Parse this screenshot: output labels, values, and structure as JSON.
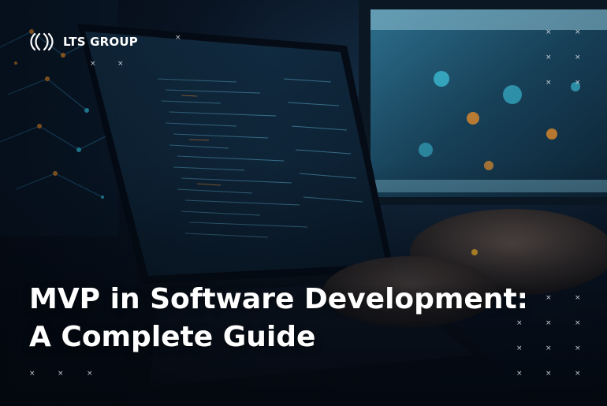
{
  "brand": {
    "name": "LTS GROUP",
    "logo_icon": "lts-logo-icon",
    "text_color": "#ffffff"
  },
  "headline": {
    "line1": "MVP in Software Development:",
    "line2": "A Complete Guide"
  },
  "decor": {
    "marker_glyph": "×"
  },
  "colors": {
    "background": "#050b14",
    "screen_glow": "#2fb6d6",
    "accent_orange": "#e08a2c"
  }
}
